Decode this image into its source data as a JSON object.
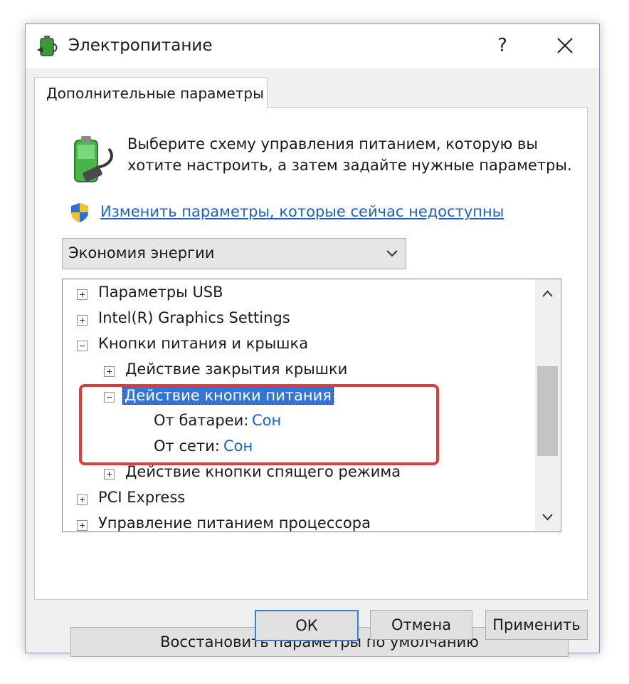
{
  "window": {
    "title": "Электропитание",
    "help": "?"
  },
  "tab": {
    "label": "Дополнительные параметры"
  },
  "description": "Выберите схему управления питанием, которую вы хотите настроить, а затем задайте нужные параметры.",
  "change_link": "Изменить параметры, которые сейчас недоступны",
  "plan_select": {
    "value": "Экономия энергии"
  },
  "tree": {
    "usb": "Параметры USB",
    "intel": "Intel(R) Graphics Settings",
    "power_buttons": "Кнопки питания и крышка",
    "lid_action": "Действие закрытия крышки",
    "power_button_action": "Действие кнопки питания",
    "on_battery_label": "От батареи:",
    "on_battery_value": "Сон",
    "plugged_in_label": "От сети:",
    "plugged_in_value": "Сон",
    "sleep_button_action": "Действие кнопки спящего режима",
    "pci": "PCI Express",
    "cpu": "Управление питанием процессора"
  },
  "buttons": {
    "restore": "Восстановить параметры по умолчанию",
    "ok": "ОК",
    "cancel": "Отмена",
    "apply": "Применить"
  },
  "icons": {
    "app": "power-options-icon",
    "battery": "battery-plug-icon",
    "shield": "uac-shield-icon"
  },
  "colors": {
    "link": "#1a5fd0",
    "selection": "#3374d8",
    "highlight": "#e03b3b"
  }
}
